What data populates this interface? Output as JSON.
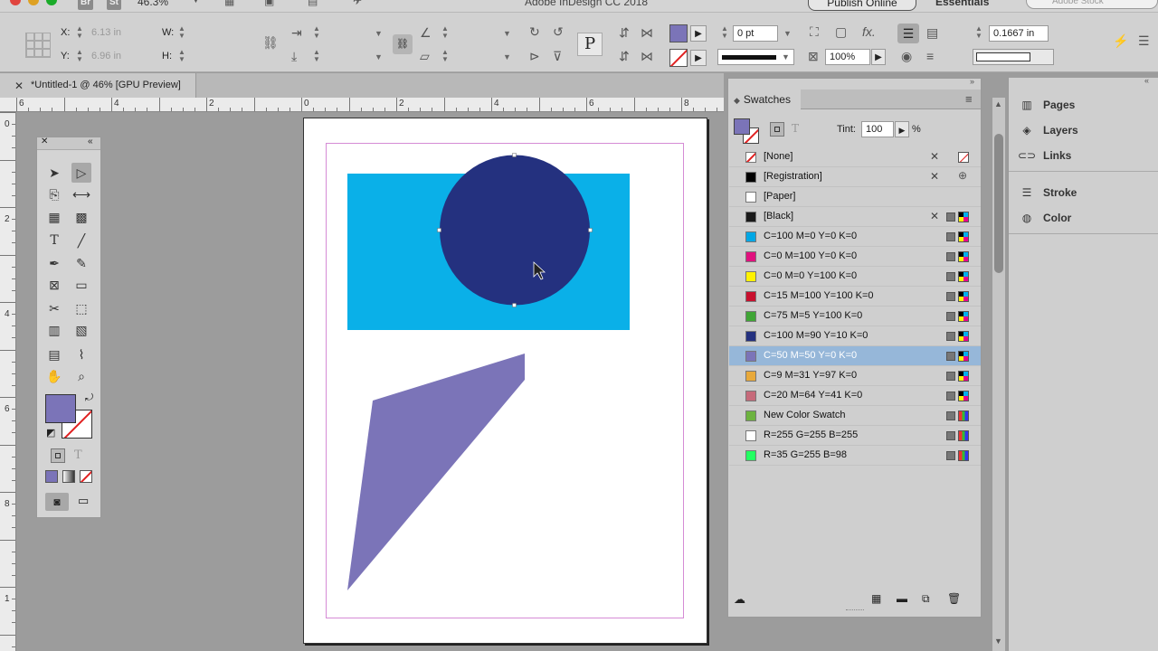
{
  "app": {
    "zoom": "46.3%",
    "title": "Adobe InDesign CC 2018",
    "publish_label": "Publish Online",
    "workspace": "Essentials",
    "stock_placeholder": "Adobe Stock",
    "btn_br": "Br",
    "btn_st": "St"
  },
  "control": {
    "x_label": "X:",
    "x_value": "6.13 in",
    "y_label": "Y:",
    "y_value": "6.96 in",
    "w_label": "W:",
    "h_label": "H:",
    "stroke_weight": "0 pt",
    "opacity": "100%",
    "gutter": "0.1667 in",
    "p_glyph": "P"
  },
  "doc": {
    "tab_label": "*Untitled-1 @ 46% [GPU Preview]"
  },
  "rulers": {
    "h_labels": [
      "6",
      "4",
      "2",
      "0",
      "2",
      "4",
      "6",
      "8"
    ],
    "v_labels": [
      "0",
      "2",
      "4",
      "6",
      "8",
      "1"
    ]
  },
  "colors": {
    "fill_swatch": "#7b74b8",
    "rect_fill": "#0ab0e8",
    "circle_fill": "#24317f",
    "poly_fill": "#7b74b8",
    "margin_guide": "#d58bd5"
  },
  "swatches": {
    "panel_title": "Swatches",
    "tint_label": "Tint:",
    "tint_value": "100",
    "tint_unit": "%",
    "items": [
      {
        "name": "[None]",
        "color": "none",
        "mode": "none",
        "locked": true,
        "selected": false
      },
      {
        "name": "[Registration]",
        "color": "#000000",
        "mode": "reg",
        "locked": true,
        "selected": false
      },
      {
        "name": "[Paper]",
        "color": "#ffffff",
        "mode": "",
        "locked": false,
        "selected": false
      },
      {
        "name": "[Black]",
        "color": "#1a1a1a",
        "mode": "cmyk",
        "locked": true,
        "selected": false
      },
      {
        "name": "C=100 M=0 Y=0 K=0",
        "color": "#00a7e5",
        "mode": "cmyk",
        "locked": false,
        "selected": false
      },
      {
        "name": "C=0 M=100 Y=0 K=0",
        "color": "#e0117e",
        "mode": "cmyk",
        "locked": false,
        "selected": false
      },
      {
        "name": "C=0 M=0 Y=100 K=0",
        "color": "#fff200",
        "mode": "cmyk",
        "locked": false,
        "selected": false
      },
      {
        "name": "C=15 M=100 Y=100 K=0",
        "color": "#c8102e",
        "mode": "cmyk",
        "locked": false,
        "selected": false
      },
      {
        "name": "C=75 M=5 Y=100 K=0",
        "color": "#3fa535",
        "mode": "cmyk",
        "locked": false,
        "selected": false
      },
      {
        "name": "C=100 M=90 Y=10 K=0",
        "color": "#24317f",
        "mode": "cmyk",
        "locked": false,
        "selected": false
      },
      {
        "name": "C=50 M=50 Y=0 K=0",
        "color": "#7b74b8",
        "mode": "cmyk",
        "locked": false,
        "selected": true
      },
      {
        "name": "C=9 M=31 Y=97 K=0",
        "color": "#e8a93a",
        "mode": "cmyk",
        "locked": false,
        "selected": false
      },
      {
        "name": "C=20 M=64 Y=41 K=0",
        "color": "#c66a7a",
        "mode": "cmyk",
        "locked": false,
        "selected": false
      },
      {
        "name": "New Color Swatch",
        "color": "#6db33f",
        "mode": "rgb",
        "locked": false,
        "selected": false
      },
      {
        "name": "R=255 G=255 B=255",
        "color": "#ffffff",
        "mode": "rgb",
        "locked": false,
        "selected": false
      },
      {
        "name": "R=35 G=255 B=98",
        "color": "#23ff62",
        "mode": "rgb",
        "locked": false,
        "selected": false
      }
    ]
  },
  "dock": {
    "items": [
      "Pages",
      "Layers",
      "Links",
      "Stroke",
      "Color"
    ]
  }
}
